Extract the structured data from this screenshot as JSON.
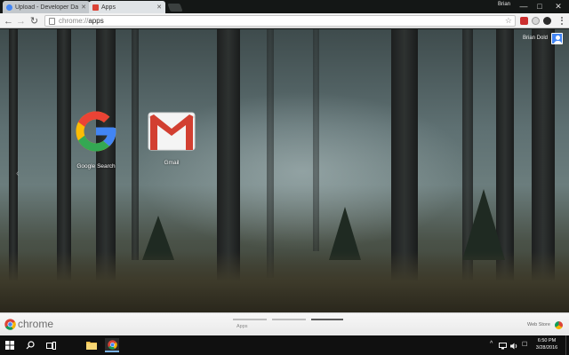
{
  "browser": {
    "tabs": [
      {
        "title": "Upload - Developer Dash",
        "active": false,
        "favicon_color": "#4285f4"
      },
      {
        "title": "Apps",
        "active": true,
        "favicon_color": "#db4437"
      }
    ],
    "profile_name": "Brian",
    "window_controls": {
      "minimize": "—",
      "maximize": "□",
      "close": "✕"
    },
    "toolbar": {
      "back_icon": "←",
      "forward_icon": "→",
      "reload_icon": "↻",
      "url_scheme": "chrome://",
      "url_rest": "apps",
      "star_icon": "☆"
    }
  },
  "apps_page": {
    "user_name": "Brian Dold",
    "prev_page_icon": "‹",
    "apps": [
      {
        "name": "Google Search",
        "icon": "google-g-icon"
      },
      {
        "name": "Gmail",
        "icon": "gmail-icon"
      }
    ]
  },
  "launcher_bar": {
    "brand": "chrome",
    "page_label": "Apps",
    "web_store_label": "Web Store"
  },
  "taskbar": {
    "start_icon": "windows-logo-icon",
    "time": "6:50 PM",
    "date": "3/28/2016",
    "tray_up_icon": "^",
    "notification_icon": "☐"
  },
  "colors": {
    "google_blue": "#4285f4",
    "google_red": "#ea4335",
    "google_yellow": "#fbbc05",
    "google_green": "#34a853"
  }
}
